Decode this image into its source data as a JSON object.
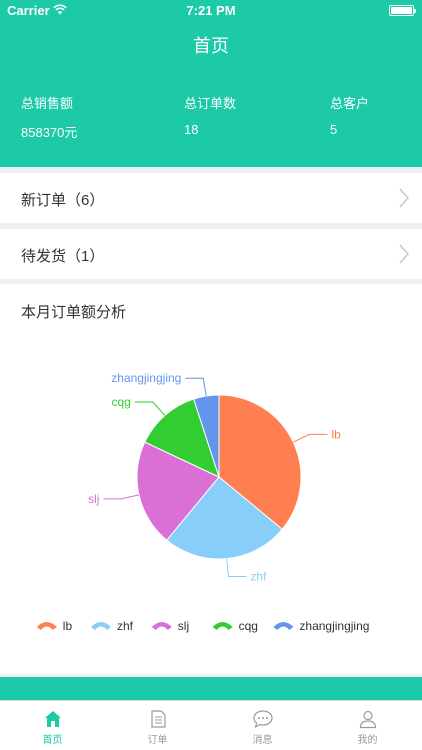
{
  "status_bar": {
    "carrier": "Carrier",
    "time": "7:21 PM"
  },
  "nav": {
    "title": "首页"
  },
  "stats": [
    {
      "label": "总销售额",
      "value": "858370元"
    },
    {
      "label": "总订单数",
      "value": "18"
    },
    {
      "label": "总客户",
      "value": "5"
    }
  ],
  "rows": [
    {
      "label": "新订单（6）"
    },
    {
      "label": "待发货（1）"
    }
  ],
  "chart_section": {
    "title": "本月订单额分析"
  },
  "chart_data": {
    "type": "pie",
    "categories": [
      "lb",
      "zhf",
      "slj",
      "cqg",
      "zhangjingjing"
    ],
    "values": [
      36,
      25,
      21,
      13,
      5
    ],
    "colors": [
      "#ff7f50",
      "#87cefa",
      "#da70d6",
      "#32cd32",
      "#6495ed"
    ],
    "legend_position": "bottom"
  },
  "tabbar": {
    "items": [
      {
        "label": "首页",
        "icon": "home-icon",
        "active": true
      },
      {
        "label": "订单",
        "icon": "document-icon",
        "active": false
      },
      {
        "label": "消息",
        "icon": "chat-bubble-icon",
        "active": false
      },
      {
        "label": "我的",
        "icon": "person-icon",
        "active": false
      }
    ],
    "active_color": "#1ccaa8"
  },
  "theme": {
    "primary": "#1ccaa8"
  }
}
